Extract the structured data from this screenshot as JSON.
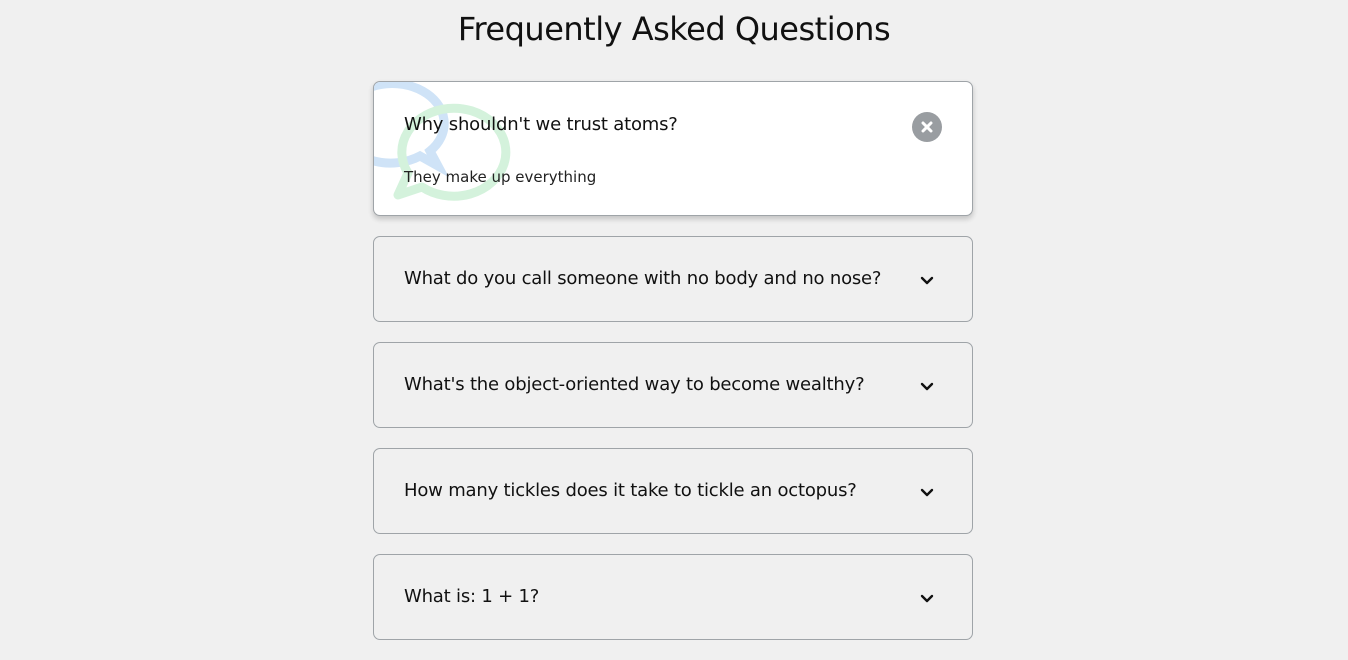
{
  "page": {
    "title": "Frequently Asked Questions"
  },
  "faqs": [
    {
      "question": "Why shouldn't we trust atoms?",
      "answer": "They make up everything",
      "expanded": true
    },
    {
      "question": "What do you call someone with no body and no nose?",
      "expanded": false
    },
    {
      "question": "What's the object-oriented way to become wealthy?",
      "expanded": false
    },
    {
      "question": "How many tickles does it take to tickle an octopus?",
      "expanded": false
    },
    {
      "question": "What is: 1 + 1?",
      "expanded": false
    }
  ],
  "icons": {
    "close": "close-icon",
    "chevron": "chevron-down-icon",
    "decoration": "speech-bubbles-icon"
  },
  "colors": {
    "background": "#f0f0f0",
    "active_card": "#ffffff",
    "close_button": "#999da1",
    "bubble_blue": "#cfe3f7",
    "bubble_green": "#d4f2dc"
  }
}
